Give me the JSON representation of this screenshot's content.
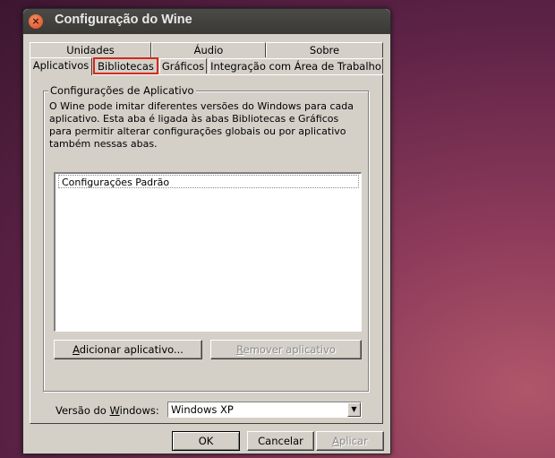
{
  "window": {
    "title": "Configuração do Wine",
    "close_glyph": "×"
  },
  "tabs": {
    "row1": [
      {
        "label": "Unidades"
      },
      {
        "label": "Áudio"
      },
      {
        "label": "Sobre"
      }
    ],
    "row2": [
      {
        "label": "Aplicativos",
        "active": true
      },
      {
        "label": "Bibliotecas",
        "highlighted": true
      },
      {
        "label": "Gráficos"
      },
      {
        "label": "Integração com Área de Trabalho"
      }
    ]
  },
  "app_settings": {
    "group_title": "Configurações de Aplicativo",
    "description": "O Wine pode imitar diferentes versões do Windows para cada aplicativo. Esta aba é ligada às abas Bibliotecas e Gráficos para permitir alterar configurações globais ou por aplicativo também nessas abas.",
    "list_items": [
      "Configurações Padrão"
    ],
    "add_button": {
      "mnemonic": "A",
      "rest": "dicionar aplicativo..."
    },
    "remove_button": {
      "mnemonic": "R",
      "rest": "emover aplicativo"
    },
    "windows_version": {
      "label_prefix": "Versão do ",
      "label_mnemonic": "W",
      "label_suffix": "indows:",
      "selected": "Windows XP"
    }
  },
  "footer": {
    "ok": "OK",
    "cancel": "Cancelar",
    "apply_mnemonic": "A",
    "apply_rest": "plicar"
  },
  "colors": {
    "highlight_outline": "#d42a1c",
    "dialog_bg": "#d4d0c8",
    "titlebar": "#3c3b37"
  }
}
